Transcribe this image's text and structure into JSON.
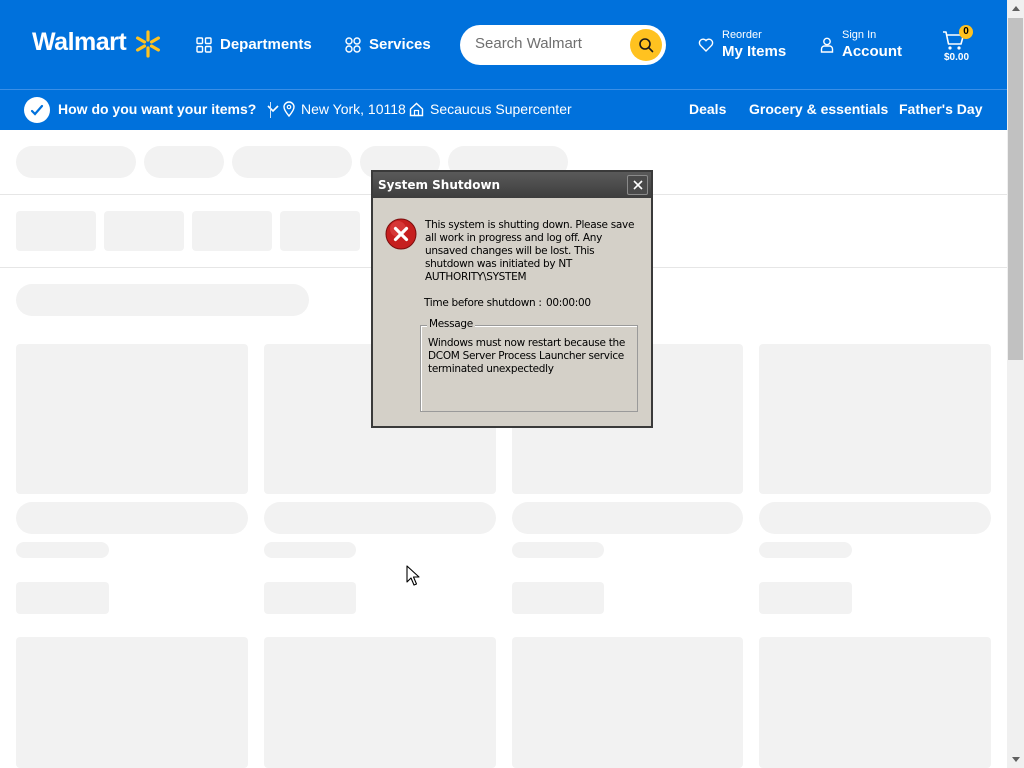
{
  "header": {
    "logo_text": "Walmart",
    "departments_label": "Departments",
    "services_label": "Services",
    "search_placeholder": "Search Walmart",
    "reorder_small": "Reorder",
    "reorder_big": "My Items",
    "signin_small": "Sign In",
    "signin_big": "Account",
    "cart_count": "0",
    "cart_total": "$0.00",
    "icons": [
      "spark-logo",
      "grid-icon",
      "services-icon",
      "search-icon",
      "heart-icon",
      "user-icon",
      "cart-icon"
    ],
    "brand_blue": "#0071dc",
    "brand_yellow": "#ffc220"
  },
  "subbar": {
    "delivery_prompt": "How do you want your items?",
    "location": "New York, 10118",
    "store": "Secaucus Supercenter",
    "links": [
      "Deals",
      "Grocery & essentials",
      "Father's Day"
    ]
  },
  "dialog": {
    "title": "System Shutdown",
    "body": "This system is shutting down. Please save all work in progress and log off. Any unsaved changes will be lost. This shutdown was initiated by NT AUTHORITY\\SYSTEM",
    "time_label": "Time before shutdown :",
    "time_value": "00:00:00",
    "message_legend": "Message",
    "message_text": "Windows must now restart because the DCOM Server Process Launcher service terminated unexpectedly"
  }
}
